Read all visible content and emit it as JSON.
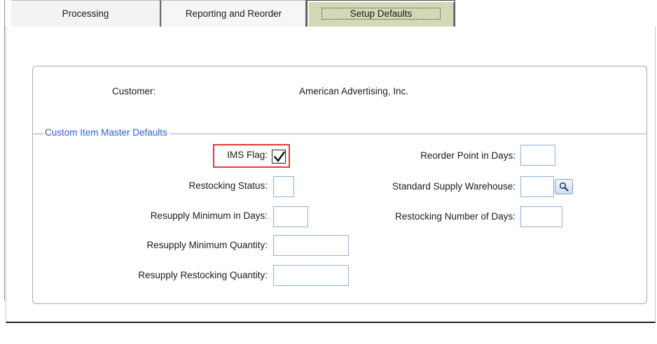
{
  "tabs": [
    {
      "label": "Processing",
      "active": false
    },
    {
      "label": "Reporting and Reorder",
      "active": false
    },
    {
      "label": "Setup Defaults",
      "active": true
    }
  ],
  "customer": {
    "label": "Customer:",
    "value": "American Advertising, Inc."
  },
  "section": {
    "title": "Custom Item Master Defaults"
  },
  "left_fields": {
    "ims_flag": {
      "label": "IMS Flag:",
      "checked": true
    },
    "restocking_status": {
      "label": "Restocking Status:",
      "value": ""
    },
    "resupply_min_days": {
      "label": "Resupply Minimum in Days:",
      "value": ""
    },
    "resupply_min_qty": {
      "label": "Resupply Minimum Quantity:",
      "value": ""
    },
    "resupply_restock_qty": {
      "label": "Resupply Restocking Quantity:",
      "value": ""
    }
  },
  "right_fields": {
    "reorder_point_days": {
      "label": "Reorder Point in Days:",
      "value": ""
    },
    "standard_supply_warehouse": {
      "label": "Standard Supply Warehouse:",
      "value": ""
    },
    "restocking_number_days": {
      "label": "Restocking Number of Days:",
      "value": ""
    }
  },
  "icons": {
    "lookup": "magnifier-icon",
    "check": "checkmark-icon"
  },
  "colors": {
    "active_tab": "#d3d8b6",
    "section_title": "#2f5fd0",
    "highlight": "#e53935",
    "field_border": "#8fb1d9"
  }
}
